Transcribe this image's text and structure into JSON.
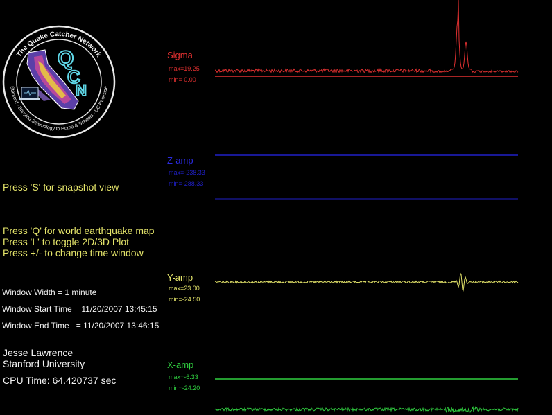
{
  "logo": {
    "ring_text_top": "The Quake Catcher Network",
    "ring_text_bottom": "Stanford  -  Bringing Seismology to Home & Schools  -  UC Riverside",
    "letters": [
      "Q",
      "C",
      "N"
    ]
  },
  "instructions": {
    "snapshot": "Press 'S' for snapshot view",
    "world_map": "Press 'Q' for world earthquake map",
    "toggle_plot": "Press 'L' to toggle 2D/3D Plot",
    "time_window": "Press +/- to change time window"
  },
  "info": {
    "window_width": "Window Width = 1 minute",
    "window_start": "Window Start Time = 11/20/2007 13:45:15",
    "window_end": "Window End Time   = 11/20/2007 13:46:15"
  },
  "credits": {
    "author": "Jesse Lawrence",
    "organization": "Stanford University",
    "cpu_time": "CPU Time: 64.420737 sec"
  },
  "channels": {
    "sigma": {
      "name": "Sigma",
      "max": "max=19.25",
      "min": "min= 0.00",
      "color": "#e03030"
    },
    "z": {
      "name": "Z-amp",
      "max": "max=-238.33",
      "min": "min=-288.33",
      "color": "#2020c8"
    },
    "y": {
      "name": "Y-amp",
      "max": "max=23.00",
      "min": "min=-24.50",
      "color": "#e4e46a"
    },
    "x": {
      "name": "X-amp",
      "max": "max=-6.33",
      "min": "min=-24.20",
      "color": "#30d040"
    }
  }
}
